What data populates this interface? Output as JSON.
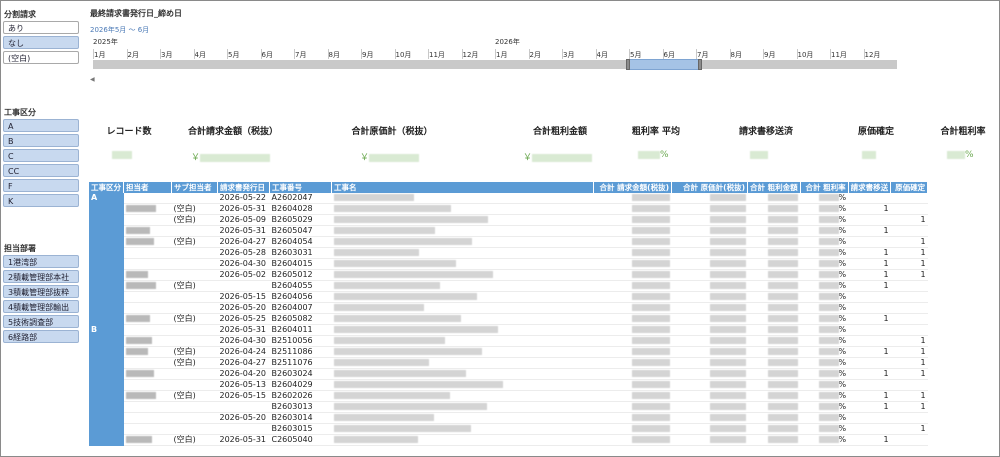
{
  "slicers": {
    "bunkatsu": {
      "title": "分割請求",
      "items": [
        "あり",
        "なし",
        "(空白)"
      ]
    },
    "koji_kubun": {
      "title": "工事区分",
      "items": [
        "A",
        "B",
        "C",
        "CC",
        "F",
        "K"
      ]
    },
    "tanto_bumon": {
      "title": "担当部署",
      "items": [
        "1港湾部",
        "2積載管理部本社",
        "3積載管理部抜粋",
        "4積載管理部輸出",
        "5技術調査部",
        "6経路部"
      ]
    }
  },
  "timeline": {
    "title": "最終請求書発行日_締め日",
    "range": "2026年5月 ～ 6月",
    "years": [
      "2025年",
      "2026年"
    ],
    "months": [
      "1月",
      "2月",
      "3月",
      "4月",
      "5月",
      "6月",
      "7月",
      "8月",
      "9月",
      "10月",
      "11月",
      "12月",
      "1月",
      "2月",
      "3月",
      "4月",
      "5月",
      "6月",
      "7月",
      "8月",
      "9月",
      "10月",
      "11月",
      "12月"
    ],
    "selection_months": "2026年5月-6月",
    "scroll_arrow": "◀"
  },
  "kpis": [
    {
      "label": "レコード数",
      "prefix": "",
      "suffix": ""
    },
    {
      "label": "合計請求金額（税抜）",
      "prefix": "￥",
      "suffix": ""
    },
    {
      "label": "合計原価計（税抜）",
      "prefix": "￥",
      "suffix": ""
    },
    {
      "label": "合計粗利金額",
      "prefix": "￥",
      "suffix": ""
    },
    {
      "label": "粗利率 平均",
      "prefix": "",
      "suffix": "%"
    },
    {
      "label": "請求書移送済",
      "prefix": "",
      "suffix": ""
    },
    {
      "label": "原価確定",
      "prefix": "",
      "suffix": ""
    },
    {
      "label": "合計粗利率",
      "prefix": "",
      "suffix": "%"
    }
  ],
  "table": {
    "columns": [
      "工事区分",
      "担当者",
      "サブ担当者",
      "請求書発行日",
      "工事番号",
      "工事名",
      "合計 請求金額(税抜)",
      "合計 原価計(税抜)",
      "合計 粗利金額",
      "合計 粗利率",
      "請求書移送",
      "原価確定"
    ],
    "rows": [
      {
        "kubun": "A",
        "sub": "",
        "date": "2026-05-22",
        "no": "A2602047",
        "pct": "%",
        "iso": "",
        "gen": ""
      },
      {
        "kubun": "",
        "sub": "(空白)",
        "date": "2026-05-31",
        "no": "B2604028",
        "pct": "%",
        "iso": "1",
        "gen": ""
      },
      {
        "kubun": "",
        "sub": "(空白)",
        "date": "2026-05-09",
        "no": "B2605029",
        "pct": "%",
        "iso": "",
        "gen": "1"
      },
      {
        "kubun": "",
        "sub": "",
        "date": "2026-05-31",
        "no": "B2605047",
        "pct": "%",
        "iso": "1",
        "gen": ""
      },
      {
        "kubun": "",
        "sub": "(空白)",
        "date": "2026-04-27",
        "no": "B2604054",
        "pct": "%",
        "iso": "",
        "gen": "1"
      },
      {
        "kubun": "",
        "sub": "",
        "date": "2026-05-28",
        "no": "B2603031",
        "pct": "%",
        "iso": "1",
        "gen": "1"
      },
      {
        "kubun": "",
        "sub": "",
        "date": "2026-04-30",
        "no": "B2604015",
        "pct": "%",
        "iso": "1",
        "gen": "1"
      },
      {
        "kubun": "",
        "sub": "",
        "date": "2026-05-02",
        "no": "B2605012",
        "pct": "%",
        "iso": "1",
        "gen": "1"
      },
      {
        "kubun": "",
        "sub": "(空白)",
        "date": "",
        "no": "B2604055",
        "pct": "%",
        "iso": "1",
        "gen": ""
      },
      {
        "kubun": "",
        "sub": "",
        "date": "2026-05-15",
        "no": "B2604056",
        "pct": "%",
        "iso": "",
        "gen": ""
      },
      {
        "kubun": "",
        "sub": "",
        "date": "2026-05-20",
        "no": "B2604007",
        "pct": "%",
        "iso": "",
        "gen": ""
      },
      {
        "kubun": "",
        "sub": "(空白)",
        "date": "2026-05-25",
        "no": "B2605082",
        "pct": "%",
        "iso": "1",
        "gen": ""
      },
      {
        "kubun": "B",
        "sub": "",
        "date": "2026-05-31",
        "no": "B2604011",
        "pct": "%",
        "iso": "",
        "gen": ""
      },
      {
        "kubun": "",
        "sub": "",
        "date": "2026-04-30",
        "no": "B2510056",
        "pct": "%",
        "iso": "",
        "gen": "1"
      },
      {
        "kubun": "",
        "sub": "(空白)",
        "date": "2026-04-24",
        "no": "B2511086",
        "pct": "%",
        "iso": "1",
        "gen": "1"
      },
      {
        "kubun": "",
        "sub": "(空白)",
        "date": "2026-04-27",
        "no": "B2511076",
        "pct": "%",
        "iso": "",
        "gen": "1"
      },
      {
        "kubun": "",
        "sub": "",
        "date": "2026-04-20",
        "no": "B2603024",
        "pct": "%",
        "iso": "1",
        "gen": "1"
      },
      {
        "kubun": "",
        "sub": "",
        "date": "2026-05-13",
        "no": "B2604029",
        "pct": "%",
        "iso": "",
        "gen": ""
      },
      {
        "kubun": "",
        "sub": "(空白)",
        "date": "2026-05-15",
        "no": "B2602026",
        "pct": "%",
        "iso": "1",
        "gen": "1"
      },
      {
        "kubun": "",
        "sub": "",
        "date": "",
        "no": "B2603013",
        "pct": "%",
        "iso": "1",
        "gen": "1"
      },
      {
        "kubun": "",
        "sub": "",
        "date": "2026-05-20",
        "no": "B2603014",
        "pct": "%",
        "iso": "",
        "gen": ""
      },
      {
        "kubun": "",
        "sub": "",
        "date": "",
        "no": "B2603015",
        "pct": "%",
        "iso": "",
        "gen": "1"
      },
      {
        "kubun": "",
        "sub": "(空白)",
        "date": "2026-05-31",
        "no": "C2605040",
        "pct": "%",
        "iso": "1",
        "gen": ""
      }
    ]
  },
  "colors": {
    "accent": "#5b9bd5",
    "selected_slicer": "#c8d9ef",
    "kpi_value": "#6aa84f",
    "timeline_selection": "#a5c3e6"
  }
}
